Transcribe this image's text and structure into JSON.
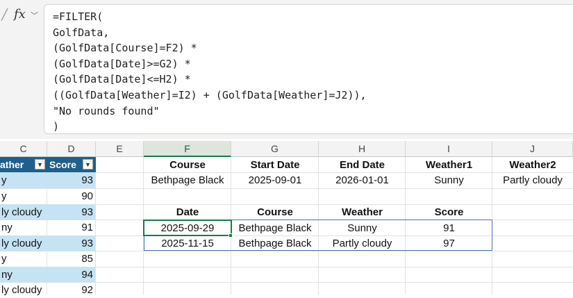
{
  "formula_bar": {
    "fx_label": "fx",
    "formula": "=FILTER(\nGolfData,\n(GolfData[Course]=F2) *\n(GolfData[Date]>=G2) *\n(GolfData[Date]<=H2) *\n((GolfData[Weather]=I2) + (GolfData[Weather]=J2)),\n\"No rounds found\"\n)"
  },
  "columns": [
    "C",
    "D",
    "E",
    "F",
    "G",
    "H",
    "I",
    "J"
  ],
  "table": {
    "headers": {
      "weather": "ather",
      "score": "Score"
    },
    "rows": [
      {
        "weather": "y",
        "score": "93"
      },
      {
        "weather": "y",
        "score": "90"
      },
      {
        "weather": "ly cloudy",
        "score": "93"
      },
      {
        "weather": "ny",
        "score": "91"
      },
      {
        "weather": "ly cloudy",
        "score": "93"
      },
      {
        "weather": "y",
        "score": "85"
      },
      {
        "weather": "ny",
        "score": "94"
      },
      {
        "weather": "ly cloudy",
        "score": "92"
      }
    ]
  },
  "criteria": {
    "headers": [
      "Course",
      "Start Date",
      "End Date",
      "Weather1",
      "Weather2"
    ],
    "values": [
      "Bethpage Black",
      "2025-09-01",
      "2026-01-01",
      "Sunny",
      "Partly cloudy"
    ]
  },
  "results": {
    "headers": [
      "Date",
      "Course",
      "Weather",
      "Score"
    ],
    "rows": [
      [
        "2025-09-29",
        "Bethpage Black",
        "Sunny",
        "91"
      ],
      [
        "2025-11-15",
        "Bethpage Black",
        "Partly cloudy",
        "97"
      ]
    ]
  },
  "colors": {
    "table_header": "#1f5f8b",
    "band": "#c5e3f3",
    "selection": "#137e43",
    "spill_border": "#4472c4"
  },
  "icons": [
    "check-icon",
    "fx-icon",
    "chevron-down-icon",
    "filter-dropdown-icon"
  ]
}
